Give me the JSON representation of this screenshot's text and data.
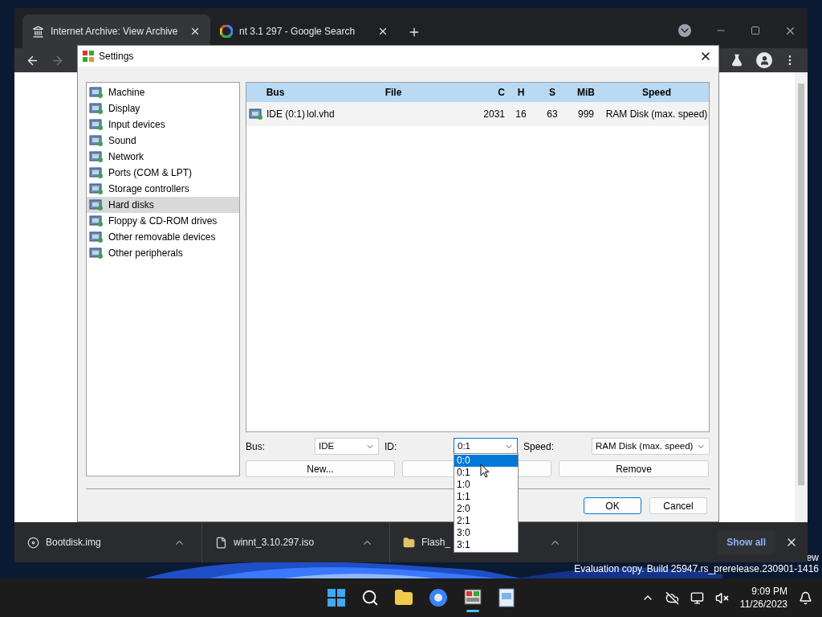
{
  "browser": {
    "tabs": [
      {
        "title": "Internet Archive: View Archive",
        "selected": true,
        "kind": "archive"
      },
      {
        "title": "nt 3.1 297 - Google Search",
        "selected": false,
        "kind": "google"
      }
    ]
  },
  "settings": {
    "title": "Settings",
    "categories": [
      {
        "label": "Machine",
        "selected": false
      },
      {
        "label": "Display",
        "selected": false
      },
      {
        "label": "Input devices",
        "selected": false
      },
      {
        "label": "Sound",
        "selected": false
      },
      {
        "label": "Network",
        "selected": false
      },
      {
        "label": "Ports (COM & LPT)",
        "selected": false
      },
      {
        "label": "Storage controllers",
        "selected": false
      },
      {
        "label": "Hard disks",
        "selected": true
      },
      {
        "label": "Floppy & CD-ROM drives",
        "selected": false
      },
      {
        "label": "Other removable devices",
        "selected": false
      },
      {
        "label": "Other peripherals",
        "selected": false
      }
    ],
    "table": {
      "columns": [
        "Bus",
        "File",
        "C",
        "H",
        "S",
        "MiB",
        "Speed"
      ],
      "rows": [
        {
          "bus": "IDE (0:1)",
          "file": "lol.vhd",
          "c": "2031",
          "h": "16",
          "s": "63",
          "mib": "999",
          "speed": "RAM Disk (max. speed)",
          "selected": false
        }
      ]
    },
    "bus": {
      "label": "Bus:",
      "value": "IDE"
    },
    "id": {
      "label": "ID:",
      "value": "0:1",
      "options": [
        {
          "label": "0:0",
          "highlighted": true
        },
        {
          "label": "0:1",
          "highlighted": false
        },
        {
          "label": "1:0",
          "highlighted": false
        },
        {
          "label": "1:1",
          "highlighted": false
        },
        {
          "label": "2:0",
          "highlighted": false
        },
        {
          "label": "2:1",
          "highlighted": false
        },
        {
          "label": "3:0",
          "highlighted": false
        },
        {
          "label": "3:1",
          "highlighted": false
        }
      ]
    },
    "speed": {
      "label": "Speed:",
      "value": "RAM Disk (max. speed)"
    },
    "new_button": "New...",
    "remove_button": "Remove",
    "dialog_buttons": [
      "OK",
      "Cancel"
    ]
  },
  "downloads": {
    "items": [
      {
        "name": "Bootdisk.img",
        "kind": "disk"
      },
      {
        "name": "winnt_3.10.297.iso",
        "kind": "file"
      },
      {
        "name": "Flash_",
        "kind": "folder"
      }
    ],
    "show_all": "Show all"
  },
  "desktop": {
    "watermark_lines": [
      "ew",
      "Evaluation copy. Build 25947.rs_prerelease.230901-1416"
    ]
  },
  "taskbar": {
    "time": "9:09 PM",
    "date": "11/26/2023"
  }
}
